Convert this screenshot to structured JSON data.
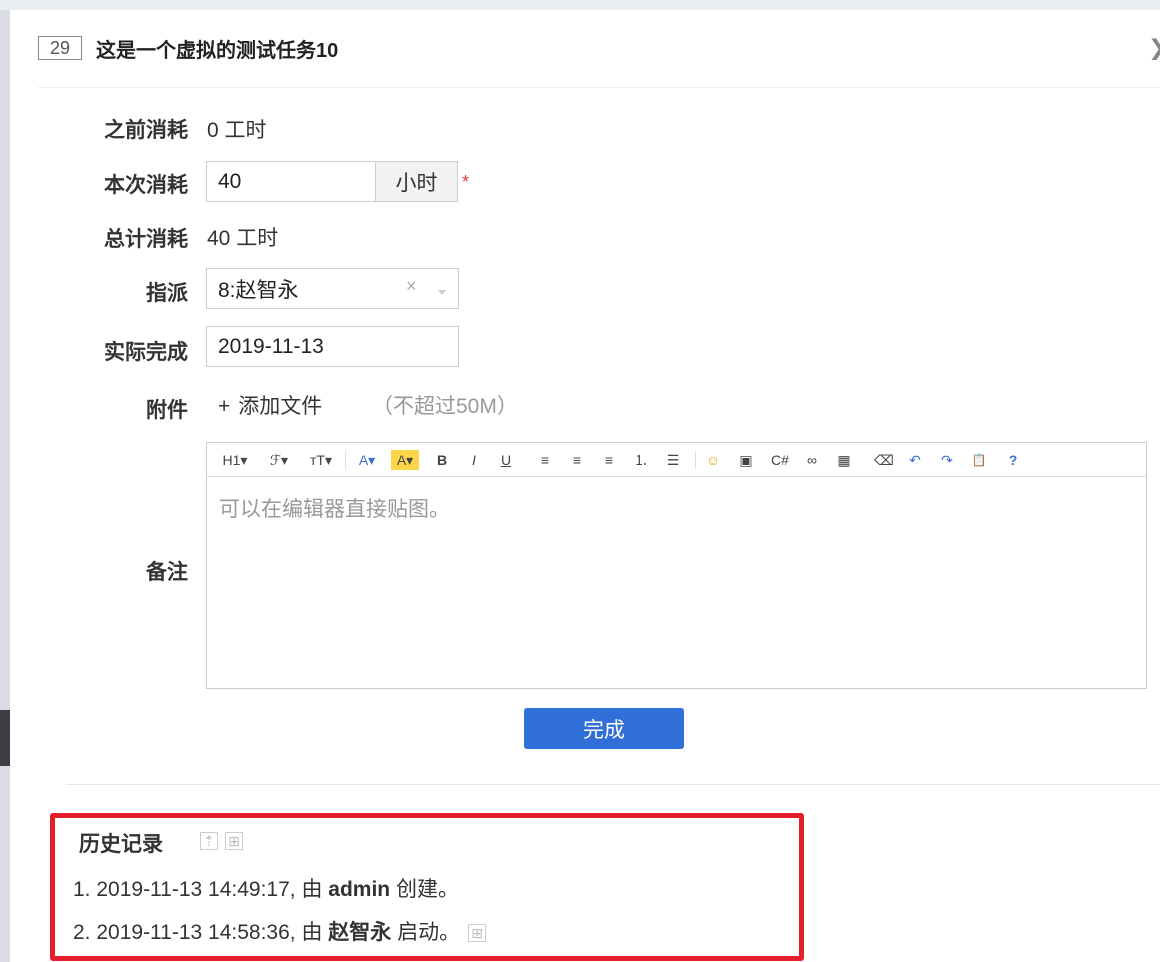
{
  "task": {
    "id": "29",
    "title": "这是一个虚拟的测试任务10"
  },
  "form": {
    "prev_consumed": {
      "label": "之前消耗",
      "value": "0 工时"
    },
    "this_consumed": {
      "label": "本次消耗",
      "value": "40",
      "unit": "小时",
      "required": "*"
    },
    "total_consumed": {
      "label": "总计消耗",
      "value": "40 工时"
    },
    "assign": {
      "label": "指派",
      "value": "8:赵智永",
      "clear": "×"
    },
    "finished_date": {
      "label": "实际完成",
      "value": "2019-11-13"
    },
    "attachment": {
      "label": "附件",
      "add_icon": "+",
      "add_label": "添加文件",
      "limit": "（不超过50M）"
    },
    "comment": {
      "label": "备注",
      "placeholder": "可以在编辑器直接贴图。"
    }
  },
  "toolbar": [
    {
      "name": "heading",
      "glyph": "H1▾"
    },
    {
      "name": "font-family",
      "glyph": "ℱ▾"
    },
    {
      "name": "font-size",
      "glyph": "тT▾"
    },
    {
      "name": "font-color",
      "glyph": "A▾"
    },
    {
      "name": "highlight",
      "glyph": "A▾"
    },
    {
      "name": "bold",
      "glyph": "B"
    },
    {
      "name": "italic",
      "glyph": "I"
    },
    {
      "name": "underline",
      "glyph": "U"
    },
    {
      "name": "align-left",
      "glyph": "≡"
    },
    {
      "name": "align-center",
      "glyph": "≡"
    },
    {
      "name": "align-right",
      "glyph": "≡"
    },
    {
      "name": "ordered-list",
      "glyph": "⒈"
    },
    {
      "name": "unordered-list",
      "glyph": "☰"
    },
    {
      "name": "emoticon",
      "glyph": "☺"
    },
    {
      "name": "image",
      "glyph": "▣"
    },
    {
      "name": "code",
      "glyph": "C#"
    },
    {
      "name": "link",
      "glyph": "∞"
    },
    {
      "name": "table",
      "glyph": "▦"
    },
    {
      "name": "clear-format",
      "glyph": "⌫"
    },
    {
      "name": "undo",
      "glyph": "↶"
    },
    {
      "name": "redo",
      "glyph": "↷"
    },
    {
      "name": "paste",
      "glyph": "📋"
    },
    {
      "name": "help",
      "glyph": "?"
    }
  ],
  "submit_label": "完成",
  "history": {
    "title": "历史记录",
    "items": [
      {
        "prefix": "1. 2019-11-13 14:49:17, 由 ",
        "actor": "admin",
        "suffix": " 创建。"
      },
      {
        "prefix": "2. 2019-11-13 14:58:36, 由 ",
        "actor": "赵智永",
        "suffix": " 启动。"
      }
    ]
  },
  "colors": {
    "primary": "#2f6fd7",
    "highlight_border": "#e41e2b",
    "required": "#ee3333"
  }
}
